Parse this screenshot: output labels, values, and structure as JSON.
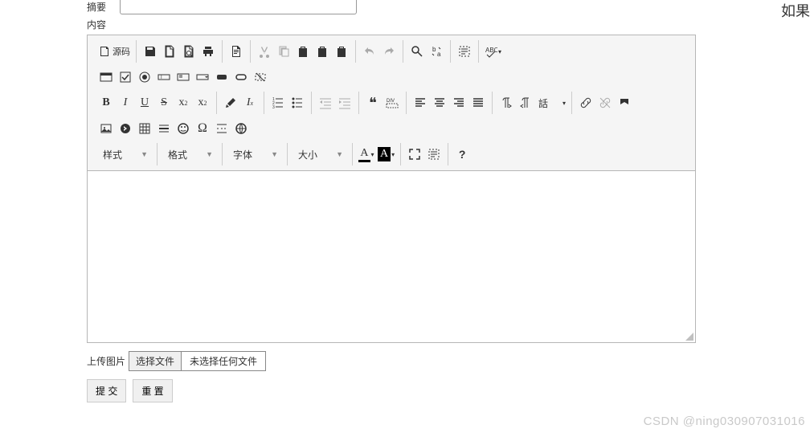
{
  "corner": "如果",
  "summary": {
    "label": "摘要"
  },
  "content": {
    "label": "内容"
  },
  "toolbar": {
    "source": "源码",
    "combos": {
      "style": "样式",
      "format": "格式",
      "font": "字体",
      "size": "大小"
    },
    "lang_combo": "話"
  },
  "upload": {
    "label": "上传图片",
    "button": "选择文件",
    "placeholder": "未选择任何文件"
  },
  "actions": {
    "submit": "提 交",
    "reset": "重 置"
  },
  "watermark": "CSDN @ning030907031016"
}
